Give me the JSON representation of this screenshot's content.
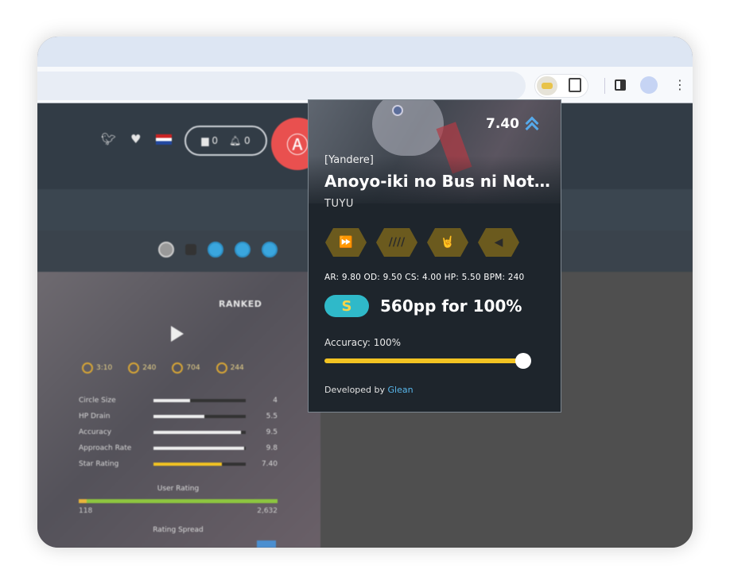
{
  "popup": {
    "star_rating": "7.40",
    "difficulty": "[Yandere]",
    "title": "Anoyo-iki no Bus ni Not...",
    "artist": "TUYU",
    "mods": [
      {
        "name": "double-time-mod-icon",
        "glyph": "⏩"
      },
      {
        "name": "hidden-mod-icon",
        "glyph": "////"
      },
      {
        "name": "hard-rock-mod-icon",
        "glyph": "🤘"
      },
      {
        "name": "flashlight-mod-icon",
        "glyph": "◀"
      }
    ],
    "mod_color": "#6b5a1e",
    "stats_line": "AR: 9.80 OD: 9.50 CS: 4.00 HP: 5.50 BPM: 240",
    "rank_letter": "S",
    "pp_text": "560pp for 100%",
    "accuracy_label": "Accuracy: 100%",
    "accuracy_fraction": 1.0,
    "credit_prefix": "Developed by",
    "credit_name": "Glean"
  },
  "page": {
    "ranked": "RANKED",
    "stat_chips": [
      "3:10",
      "240",
      "704",
      "244"
    ],
    "difficulty_rows": [
      {
        "label": "Circle Size",
        "value": "4",
        "fraction": 0.4
      },
      {
        "label": "HP Drain",
        "value": "5.5",
        "fraction": 0.55
      },
      {
        "label": "Accuracy",
        "value": "9.5",
        "fraction": 0.95
      },
      {
        "label": "Approach Rate",
        "value": "9.8",
        "fraction": 0.98
      },
      {
        "label": "Star Rating",
        "value": "7.40",
        "fraction": 0.74
      }
    ],
    "user_rating": "User Rating",
    "user_rating_low": "118",
    "user_rating_high": "2,632",
    "rating_spread": "Rating Spread",
    "comments": "0",
    "notifications": "0",
    "page_marker": "8"
  }
}
